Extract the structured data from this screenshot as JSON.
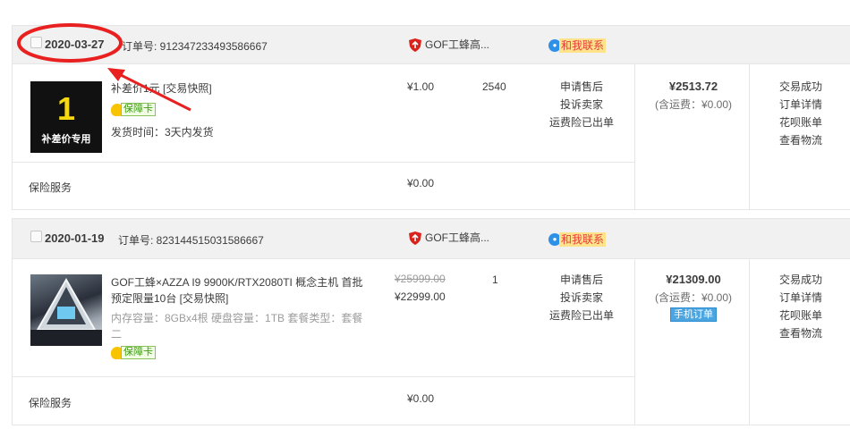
{
  "orders": [
    {
      "date": "2020-03-27",
      "order_no": "订单号: 912347233493586667",
      "shop": "GOF工蜂高...",
      "contact": "和我联系",
      "item": {
        "thumb_big": "1",
        "thumb_small": "补差价专用",
        "title": "补差价1元 [交易快照]",
        "badge": "保障卡",
        "shipping": "发货时间：3天内发货",
        "price": "¥1.00",
        "qty": "2540",
        "ops": [
          "申请售后",
          "投诉卖家",
          "运费险已出单"
        ]
      },
      "total": "¥2513.72",
      "total_ship": "(含运费：¥0.00)",
      "status": [
        "交易成功",
        "订单详情",
        "花呗账单",
        "查看物流"
      ],
      "insurance": "保险服务",
      "insurance_price": "¥0.00"
    },
    {
      "date": "2020-01-19",
      "order_no": "订单号: 823144515031586667",
      "shop": "GOF工蜂高...",
      "contact": "和我联系",
      "item": {
        "title": "GOF工蜂×AZZA I9 9900K/RTX2080TI 概念主机 首批预定限量10台 [交易快照]",
        "spec": "内存容量：8GBx4根   硬盘容量：1TB   套餐类型：套餐二",
        "badge": "保障卡",
        "price_old": "¥25999.00",
        "price_new": "¥22999.00",
        "qty": "1",
        "ops": [
          "申请售后",
          "投诉卖家",
          "运费险已出单"
        ]
      },
      "total": "¥21309.00",
      "total_ship": "(含运费：¥0.00)",
      "mobile_tag": "手机订单",
      "status": [
        "交易成功",
        "订单详情",
        "花呗账单",
        "查看物流"
      ],
      "insurance": "保险服务",
      "insurance_price": "¥0.00"
    }
  ],
  "colors": {
    "header_bg": "#f1f1f1",
    "annotation_red": "#e8201f",
    "contact_bg": "#fee38a",
    "badge_green": "#3a9a0e",
    "mobile_tag_blue": "#4aa5e0"
  },
  "icons": [
    "checkbox-icon",
    "shop-shield-icon",
    "wangwang-icon",
    "guarantee-icon",
    "annotation-ellipse",
    "annotation-arrow"
  ]
}
